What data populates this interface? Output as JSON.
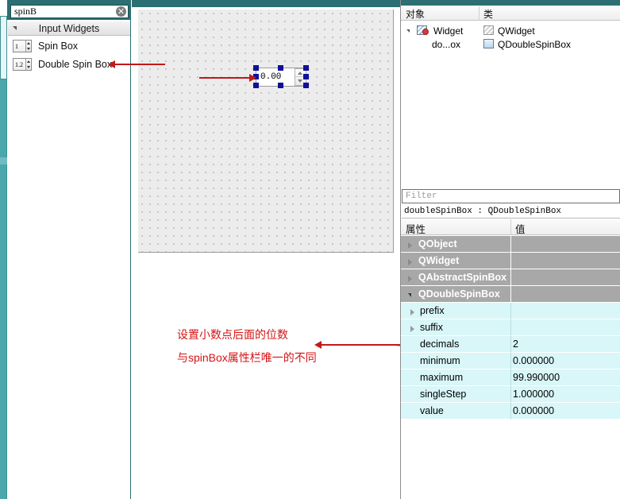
{
  "widget_box": {
    "search": {
      "value": "spinB",
      "placeholder": "",
      "clear_icon": "clear-circle-icon"
    },
    "category": {
      "label": "Input Widgets",
      "expanded": true
    },
    "items": [
      {
        "label": "Spin Box",
        "icon": "spinbox-icon",
        "icon_text": "1"
      },
      {
        "label": "Double Spin Box",
        "icon": "double-spinbox-icon",
        "icon_text": "1.2"
      }
    ]
  },
  "canvas": {
    "widget": {
      "text": "0.00",
      "selected": true,
      "type": "QDoubleSpinBox"
    }
  },
  "annotations": {
    "line1": "设置小数点后面的位数",
    "line2": "与spinBox属性栏唯一的不同",
    "color": "#d41313"
  },
  "object_inspector": {
    "columns": [
      "对象",
      "类"
    ],
    "rows": [
      {
        "name": "Widget",
        "class": "QWidget",
        "indent": 0,
        "expanded": true,
        "icon": "form-widget-icon"
      },
      {
        "name": "do...ox",
        "class": "QDoubleSpinBox",
        "indent": 1,
        "expanded": false,
        "icon": "double-spinbox-icon"
      }
    ]
  },
  "property_editor": {
    "filter_placeholder": "Filter",
    "object_title": "doubleSpinBox : QDoubleSpinBox",
    "columns": [
      "属性",
      "值"
    ],
    "rows": [
      {
        "kind": "group",
        "name": "QObject",
        "value": "",
        "expanded": false
      },
      {
        "kind": "group",
        "name": "QWidget",
        "value": "",
        "expanded": false
      },
      {
        "kind": "group",
        "name": "QAbstractSpinBox",
        "value": "",
        "expanded": false
      },
      {
        "kind": "group",
        "name": "QDoubleSpinBox",
        "value": "",
        "expanded": true
      },
      {
        "kind": "item",
        "name": "prefix",
        "value": "",
        "expandable": true
      },
      {
        "kind": "item",
        "name": "suffix",
        "value": "",
        "expandable": true
      },
      {
        "kind": "item",
        "name": "decimals",
        "value": "2",
        "expandable": false
      },
      {
        "kind": "item",
        "name": "minimum",
        "value": "0.000000",
        "expandable": false
      },
      {
        "kind": "item",
        "name": "maximum",
        "value": "99.990000",
        "expandable": false
      },
      {
        "kind": "item",
        "name": "singleStep",
        "value": "1.000000",
        "expandable": false
      },
      {
        "kind": "item",
        "name": "value",
        "value": "0.000000",
        "expandable": false
      }
    ]
  },
  "theme": {
    "accent_teal": "#2b6f73",
    "scrollbar_teal": "#4aa7ac",
    "group_gray": "#a8a8a8",
    "row_cyan": "#d9f6f8",
    "annotation_red": "#d41313"
  }
}
